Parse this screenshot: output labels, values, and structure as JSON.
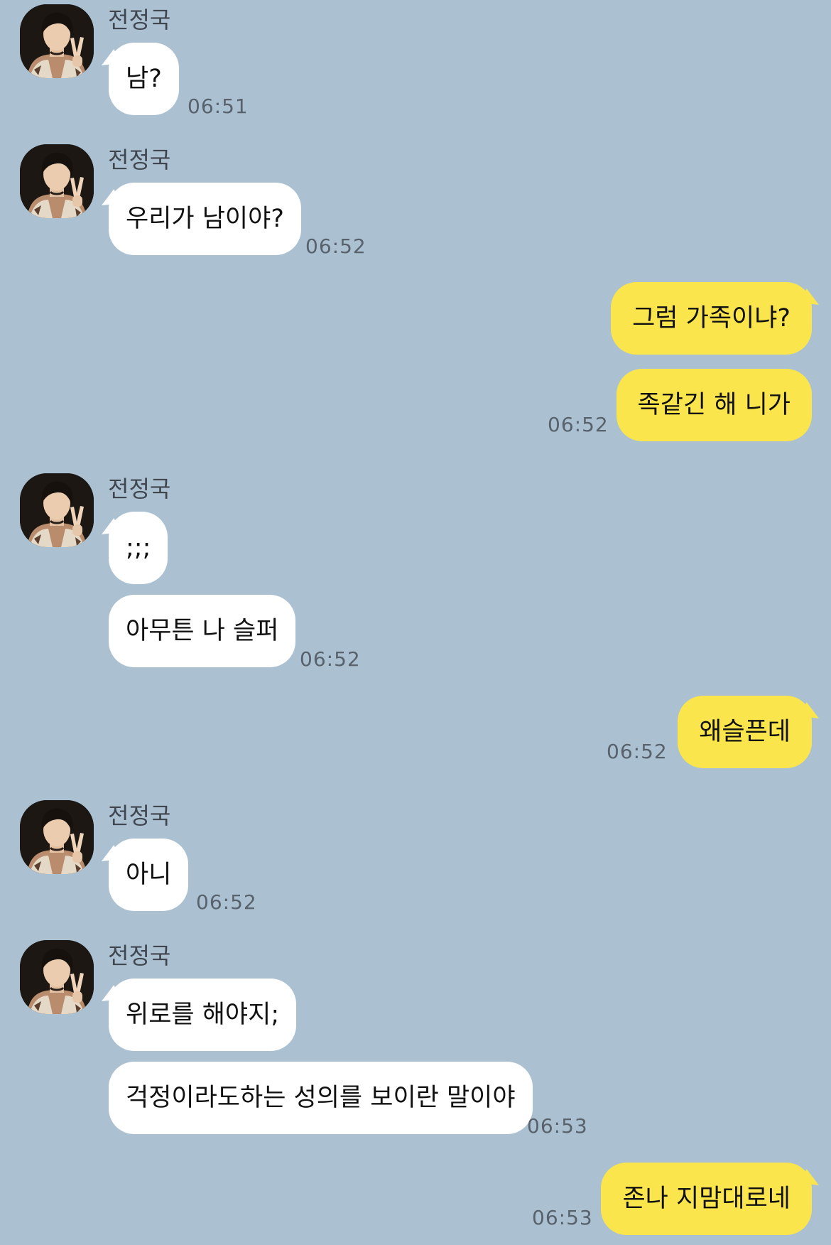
{
  "chat": {
    "partner_name": "전정국",
    "avatar_icon": "profile-photo",
    "colors": {
      "background": "#abc1d1",
      "incoming_bubble": "#ffffff",
      "outgoing_bubble": "#fae54d"
    },
    "messages": [
      {
        "from": "partner",
        "text": "남?",
        "time": "06:51"
      },
      {
        "from": "partner",
        "text": "우리가 남이야?",
        "time": "06:52"
      },
      {
        "from": "me",
        "text": "그럼 가족이냐?",
        "time": ""
      },
      {
        "from": "me",
        "text": "족같긴 해 니가",
        "time": "06:52"
      },
      {
        "from": "partner",
        "text": ";;;",
        "time": ""
      },
      {
        "from": "partner",
        "text": "아무튼 나 슬퍼",
        "time": "06:52"
      },
      {
        "from": "me",
        "text": "왜슬픈데",
        "time": "06:52"
      },
      {
        "from": "partner",
        "text": "아니",
        "time": "06:52"
      },
      {
        "from": "partner",
        "text": "위로를 해야지;",
        "time": ""
      },
      {
        "from": "partner",
        "text": "걱정이라도하는 성의를 보이란 말이야",
        "time": "06:53"
      },
      {
        "from": "me",
        "text": "존나 지맘대로네",
        "time": "06:53"
      }
    ]
  }
}
